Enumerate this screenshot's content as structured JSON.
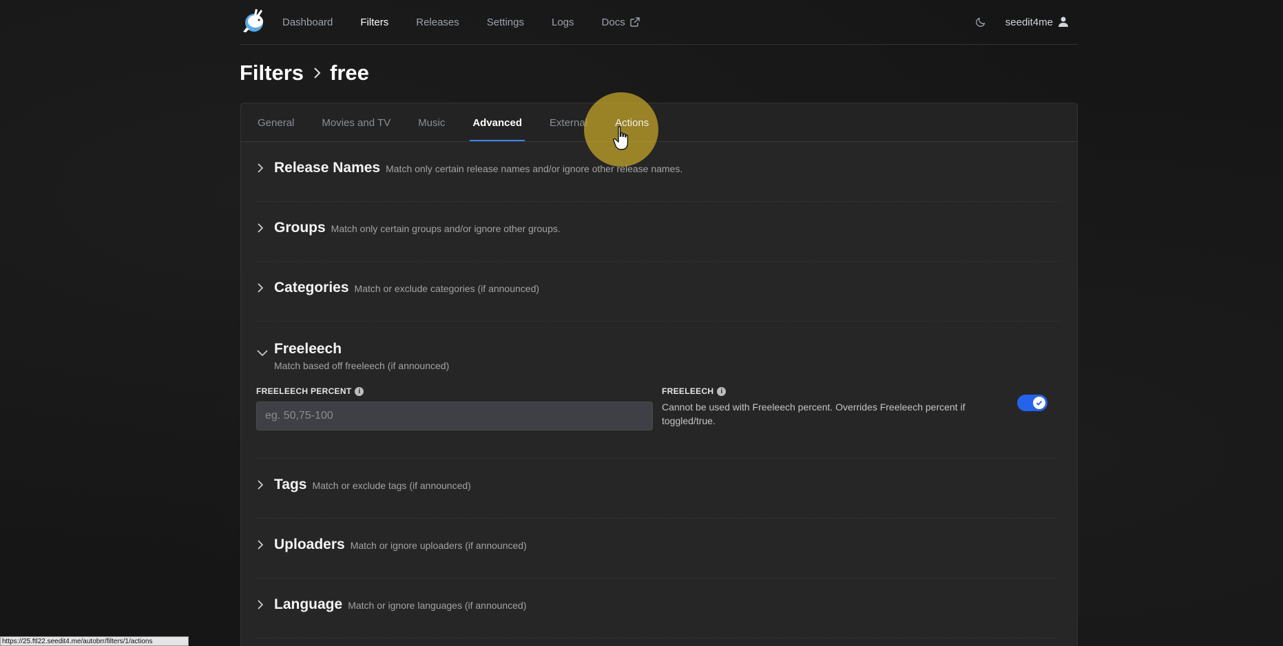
{
  "nav": {
    "links": [
      {
        "label": "Dashboard",
        "active": false
      },
      {
        "label": "Filters",
        "active": true
      },
      {
        "label": "Releases",
        "active": false
      },
      {
        "label": "Settings",
        "active": false
      },
      {
        "label": "Logs",
        "active": false
      },
      {
        "label": "Docs",
        "active": false
      }
    ],
    "username": "seedit4me"
  },
  "breadcrumb": {
    "root": "Filters",
    "current": "free"
  },
  "tabs": [
    "General",
    "Movies and TV",
    "Music",
    "Advanced",
    "External",
    "Actions"
  ],
  "active_tab": "Advanced",
  "sections_top": [
    {
      "title": "Release Names",
      "desc": "Match only certain release names and/or ignore other release names."
    },
    {
      "title": "Groups",
      "desc": "Match only certain groups and/or ignore other groups."
    },
    {
      "title": "Categories",
      "desc": "Match or exclude categories (if announced)"
    }
  ],
  "freeleech": {
    "title": "Freeleech",
    "desc": "Match based off freeleech (if announced)",
    "percent_label": "FREELEECH PERCENT",
    "percent_placeholder": "eg. 50,75-100",
    "toggle_label": "FREELEECH",
    "toggle_desc": "Cannot be used with Freeleech percent. Overrides Freeleech percent if toggled/true.",
    "toggle_on": true
  },
  "sections_bottom": [
    {
      "title": "Tags",
      "desc": "Match or exclude tags (if announced)"
    },
    {
      "title": "Uploaders",
      "desc": "Match or ignore uploaders (if announced)"
    },
    {
      "title": "Language",
      "desc": "Match or ignore languages (if announced)"
    }
  ],
  "status_url": "https://25.ftl22.seedit4.me/autobrr/filters/1/actions",
  "colors": {
    "accent": "#3b82f6",
    "highlight": "#c9a828",
    "toggle": "#2563eb"
  }
}
